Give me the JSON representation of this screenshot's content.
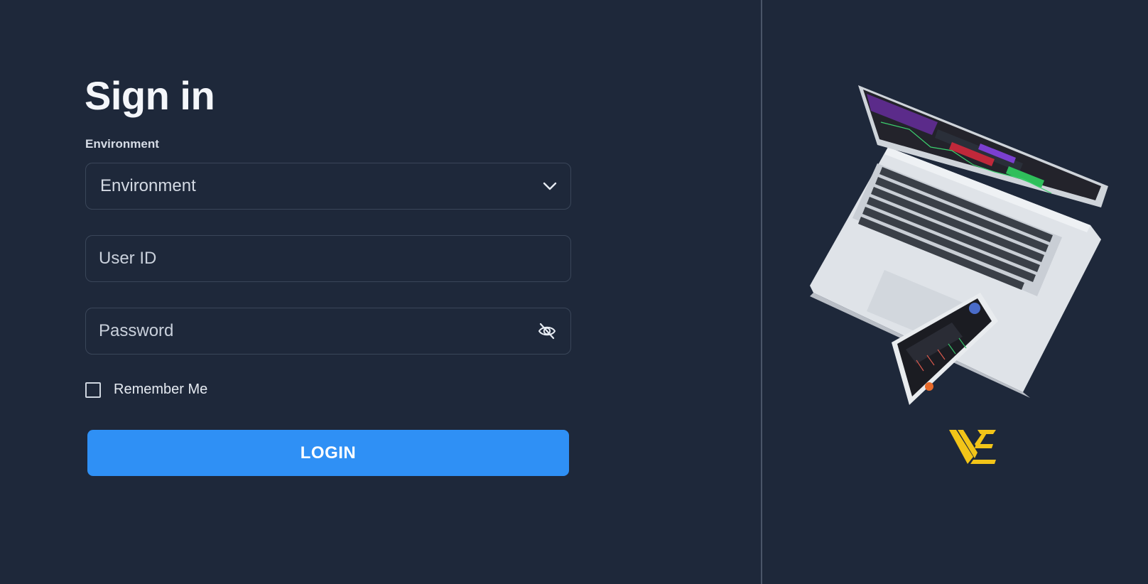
{
  "form": {
    "title": "Sign in",
    "environment_label": "Environment",
    "environment_select": {
      "selected": "Environment"
    },
    "user_id": {
      "placeholder": "User ID",
      "value": ""
    },
    "password": {
      "placeholder": "Password",
      "value": ""
    },
    "remember_me": {
      "label": "Remember Me",
      "checked": false
    },
    "login_button": "LOGIN"
  },
  "icons": {
    "select_chevron": "chevron-down-icon",
    "password_toggle": "eye-off-icon"
  },
  "colors": {
    "background": "#1e283a",
    "accent": "#2f90f5",
    "logo": "#f2c418"
  }
}
